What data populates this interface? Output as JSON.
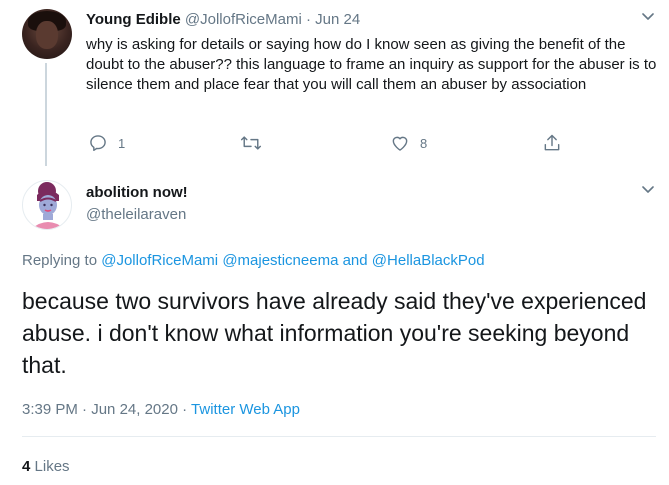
{
  "parent_tweet": {
    "display_name": "Young Edible",
    "handle": "@JollofRiceMami",
    "separator": "·",
    "date": "Jun 24",
    "text": "why is asking for details or saying how do I know seen as giving the benefit of the doubt to the abuser?? this language to frame an inquiry as support for the abuser is to silence them and place fear that you will call them an abuser by association",
    "actions": {
      "reply_count": "1",
      "retweet_count": "",
      "like_count": "8"
    }
  },
  "main_tweet": {
    "display_name": "abolition now!",
    "handle": "@theleilaraven",
    "replying_prefix": "Replying to",
    "mentions": [
      "@JollofRiceMami",
      "@majesticneema"
    ],
    "and_text": "and",
    "last_mention": "@HellaBlackPod",
    "text": "because two survivors have already said they've experienced abuse. i don't know what information you're seeking beyond that.",
    "time": "3:39 PM",
    "separator": "·",
    "date": "Jun 24, 2020",
    "separator2": "·",
    "source": "Twitter Web App",
    "likes_count": "4",
    "likes_label": "Likes"
  },
  "colors": {
    "accent": "#1b95e0",
    "muted": "#657786",
    "text": "#14171a",
    "divider": "#e6ecf0"
  },
  "icons": [
    "chevron-down-icon",
    "reply-icon",
    "retweet-icon",
    "heart-icon",
    "share-icon"
  ]
}
